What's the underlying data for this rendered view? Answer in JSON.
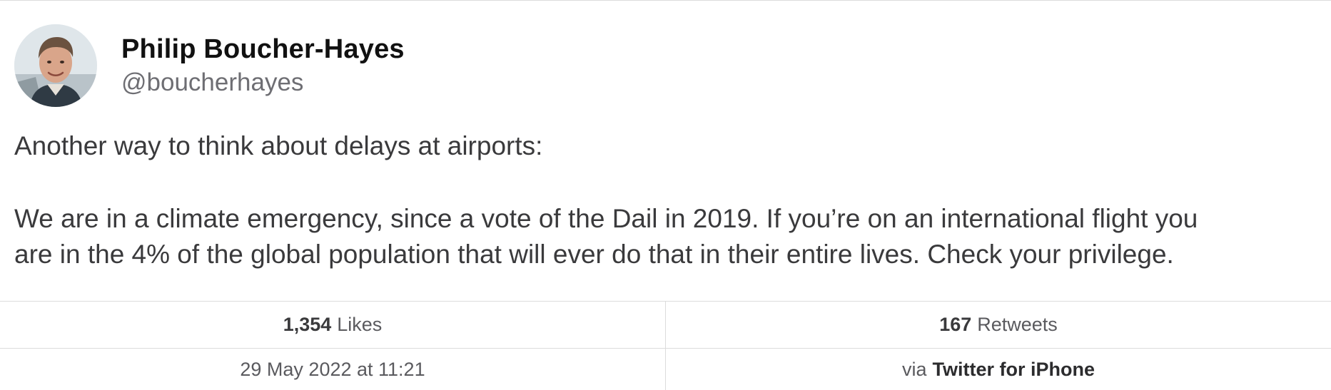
{
  "author": {
    "display_name": "Philip Boucher-Hayes",
    "handle": "@boucherhayes",
    "avatar_icon": "profile-photo"
  },
  "tweet": {
    "line_1": "Another way to think about delays at airports:",
    "line_2": "We are in a climate emergency, since a vote of the Dail in 2019. If you’re on an international flight you",
    "line_3": "are in the 4% of the global population that will ever do that in their entire lives. Check your privilege."
  },
  "stats": {
    "likes_count": "1,354",
    "likes_label": "Likes",
    "retweets_count": "167",
    "retweets_label": "Retweets",
    "timestamp": "29 May 2022 at 11:21",
    "via_label": "via",
    "client": "Twitter for iPhone"
  },
  "colors": {
    "divider": "#dcdcdc",
    "text_primary": "#111111",
    "text_body": "#3a3a3c",
    "text_secondary": "#6e6e73"
  }
}
